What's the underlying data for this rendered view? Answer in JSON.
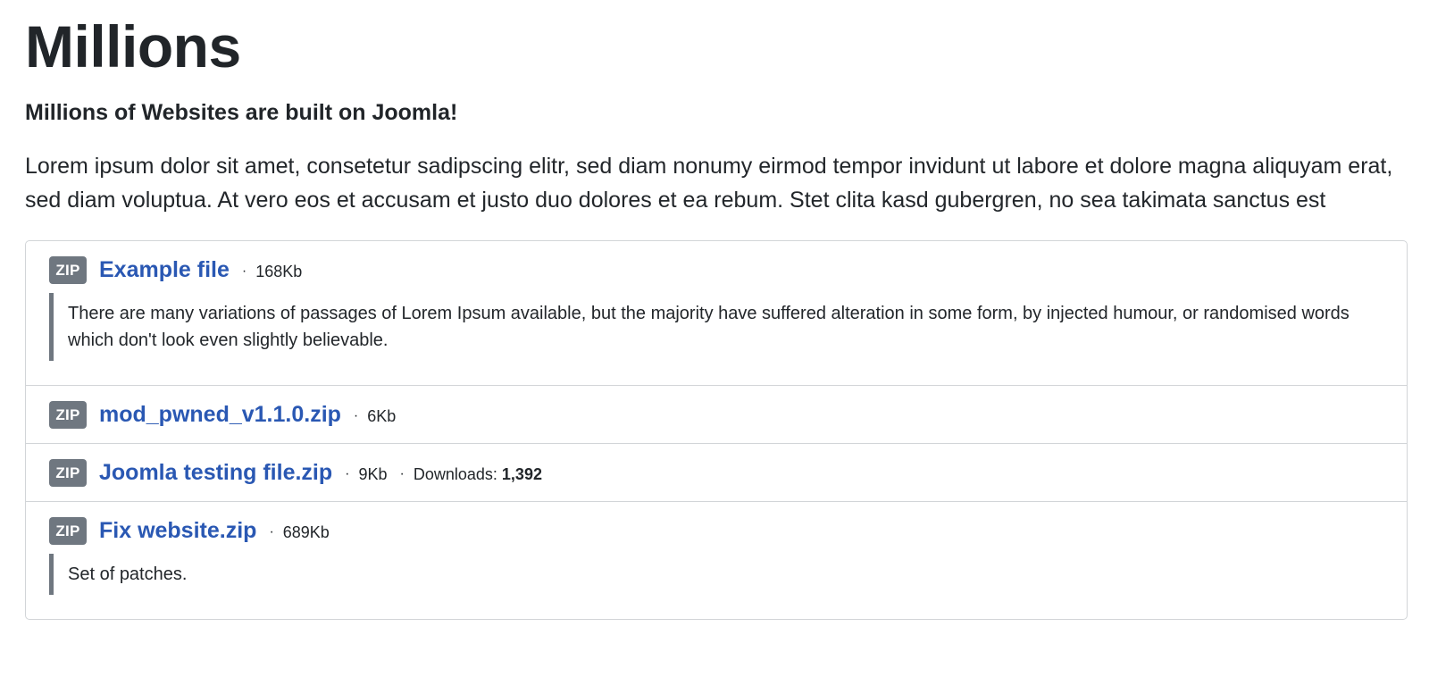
{
  "page": {
    "title": "Millions",
    "subtitle": "Millions of Websites are built on Joomla!",
    "intro": "Lorem ipsum dolor sit amet, consetetur sadipscing elitr, sed diam nonumy eirmod tempor invidunt ut labore et dolore magna aliquyam erat, sed diam voluptua. At vero eos et accusam et justo duo dolores et ea rebum. Stet clita kasd gubergren, no sea takimata sanctus est"
  },
  "separator": "·",
  "downloads_label": "Downloads:",
  "files": [
    {
      "badge": "ZIP",
      "name": "Example file",
      "size": "168Kb",
      "description": "There are many variations of passages of Lorem Ipsum available, but the majority have suffered alteration in some form, by injected humour, or randomised words which don't look even slightly believable."
    },
    {
      "badge": "ZIP",
      "name": "mod_pwned_v1.1.0.zip",
      "size": "6Kb"
    },
    {
      "badge": "ZIP",
      "name": "Joomla testing file.zip",
      "size": "9Kb",
      "downloads": "1,392"
    },
    {
      "badge": "ZIP",
      "name": "Fix website.zip",
      "size": "689Kb",
      "description": "Set of patches."
    }
  ],
  "colors": {
    "link": "#2a58b3",
    "badge_bg": "#6f7780",
    "border": "#d2d5d8",
    "text": "#22262a"
  }
}
